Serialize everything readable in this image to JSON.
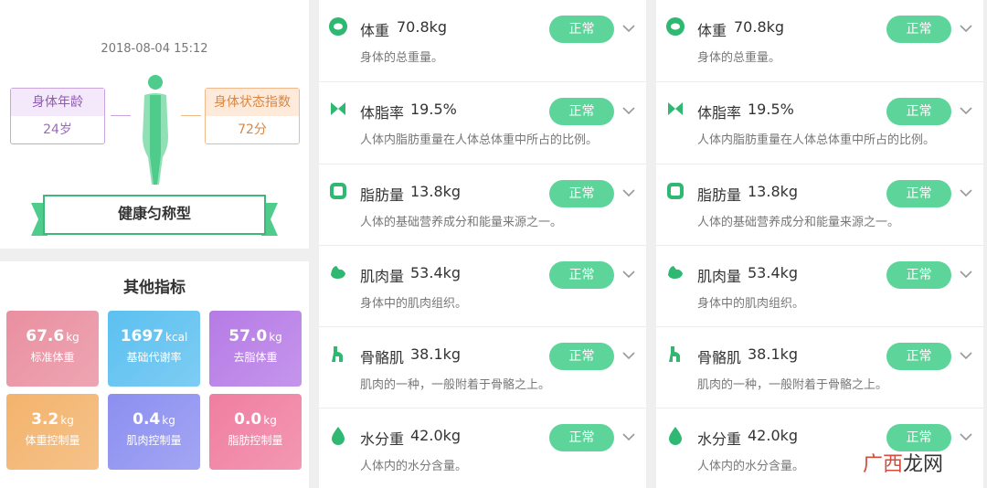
{
  "profile": {
    "datetime": "2018-08-04 15:12",
    "age_label": "身体年龄",
    "age_value": "24岁",
    "state_label": "身体状态指数",
    "state_value": "72分",
    "body_type": "健康匀称型"
  },
  "other_metrics": {
    "title": "其他指标",
    "tiles": [
      {
        "value": "67.6",
        "unit": "kg",
        "label": "标准体重",
        "color": "#e98fa0"
      },
      {
        "value": "1697",
        "unit": "kcal",
        "label": "基础代谢率",
        "color": "#5cc0f0"
      },
      {
        "value": "57.0",
        "unit": "kg",
        "label": "去脂体重",
        "color": "#b67be6"
      },
      {
        "value": "3.2",
        "unit": "kg",
        "label": "体重控制量",
        "color": "#f3b36c"
      },
      {
        "value": "0.4",
        "unit": "kg",
        "label": "肌肉控制量",
        "color": "#8c8ff0"
      },
      {
        "value": "0.0",
        "unit": "kg",
        "label": "脂肪控制量",
        "color": "#f07ea0"
      }
    ]
  },
  "panels": [
    {
      "rows": [
        {
          "icon": "scale-icon",
          "name": "体重",
          "value": "70.8kg",
          "desc": "身体的总重量。",
          "status": "正常"
        },
        {
          "icon": "fat-rate-icon",
          "name": "体脂率",
          "value": "19.5%",
          "desc": "人体内脂肪重量在人体总体重中所占的比例。",
          "status": "正常"
        },
        {
          "icon": "fat-mass-icon",
          "name": "脂肪量",
          "value": "13.8kg",
          "desc": "人体的基础营养成分和能量来源之一。",
          "status": "正常"
        },
        {
          "icon": "muscle-icon",
          "name": "肌肉量",
          "value": "53.4kg",
          "desc": "身体中的肌肉组织。",
          "status": "正常"
        },
        {
          "icon": "skeletal-muscle-icon",
          "name": "骨骼肌",
          "value": "38.1kg",
          "desc": "肌肉的一种，一般附着于骨骼之上。",
          "status": "正常"
        },
        {
          "icon": "water-drop-icon",
          "name": "水分重",
          "value": "42.0kg",
          "desc": "人体内的水分含量。",
          "status": "正常"
        }
      ]
    },
    {
      "rows": [
        {
          "icon": "scale-icon",
          "name": "体重",
          "value": "70.8kg",
          "desc": "身体的总重量。",
          "status": "正常"
        },
        {
          "icon": "fat-rate-icon",
          "name": "体脂率",
          "value": "19.5%",
          "desc": "人体内脂肪重量在人体总体重中所占的比例。",
          "status": "正常"
        },
        {
          "icon": "fat-mass-icon",
          "name": "脂肪量",
          "value": "13.8kg",
          "desc": "人体的基础营养成分和能量来源之一。",
          "status": "正常"
        },
        {
          "icon": "muscle-icon",
          "name": "肌肉量",
          "value": "53.4kg",
          "desc": "身体中的肌肉组织。",
          "status": "正常"
        },
        {
          "icon": "skeletal-muscle-icon",
          "name": "骨骼肌",
          "value": "38.1kg",
          "desc": "肌肉的一种，一般附着于骨骼之上。",
          "status": "正常"
        },
        {
          "icon": "water-drop-icon",
          "name": "水分重",
          "value": "42.0kg",
          "desc": "人体内的水分含量。",
          "status": "正常"
        }
      ]
    }
  ],
  "colors": {
    "accent": "#5dd59a",
    "icon": "#2fb872"
  },
  "watermark": {
    "part1": "广西",
    "part2": "龙网"
  }
}
